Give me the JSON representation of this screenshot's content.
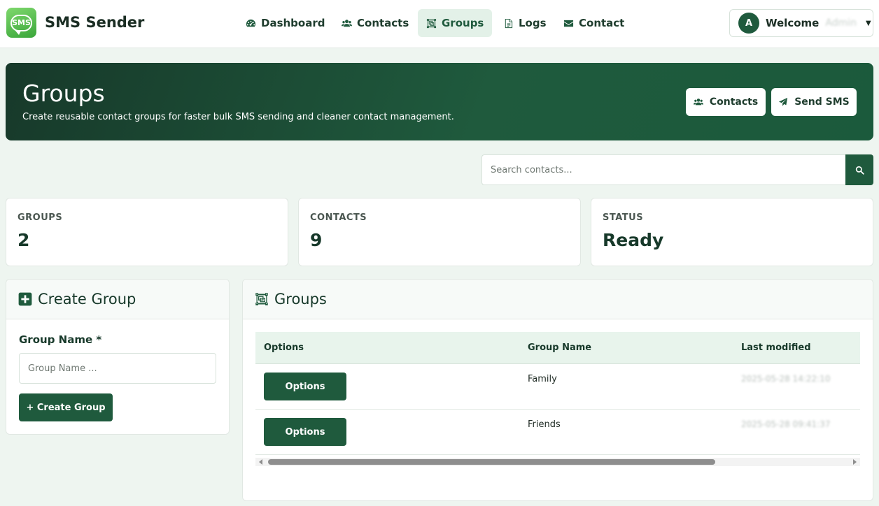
{
  "brand": {
    "logo_text": "SMS",
    "name": "SMS Sender"
  },
  "nav": {
    "items": [
      {
        "label": "Dashboard",
        "icon": "dashboard-icon"
      },
      {
        "label": "Contacts",
        "icon": "users-icon"
      },
      {
        "label": "Groups",
        "icon": "group-icon",
        "active": true
      },
      {
        "label": "Logs",
        "icon": "file-icon"
      },
      {
        "label": "Contact",
        "icon": "envelope-icon"
      }
    ],
    "user": {
      "initial": "A",
      "welcome": "Welcome",
      "name": "Admin"
    }
  },
  "hero": {
    "title": "Groups",
    "subtitle": "Create reusable contact groups for faster bulk SMS sending and cleaner contact management.",
    "buttons": [
      {
        "label": "Contacts",
        "icon": "users-icon"
      },
      {
        "label": "Send SMS",
        "icon": "paper-plane-icon"
      }
    ]
  },
  "search": {
    "placeholder": "Search contacts...",
    "icon": "search-icon"
  },
  "stats": [
    {
      "label": "GROUPS",
      "value": "2"
    },
    {
      "label": "CONTACTS",
      "value": "9"
    },
    {
      "label": "STATUS",
      "value": "Ready"
    }
  ],
  "create_panel": {
    "title": "Create Group",
    "icon": "plus-square-icon",
    "field_label": "Group Name *",
    "placeholder": "Group Name ...",
    "button_label": "+ Create Group"
  },
  "groups_panel": {
    "title": "Groups",
    "icon": "group-icon",
    "columns": [
      "Options",
      "Group Name",
      "Last modified"
    ],
    "rows": [
      {
        "button": "Options",
        "name": "Family",
        "modified": "2025-05-28 14:22:10"
      },
      {
        "button": "Options",
        "name": "Friends",
        "modified": "2025-05-28 09:41:37"
      }
    ]
  },
  "colors": {
    "primary": "#1f5a3d",
    "hero_dark": "#17392a",
    "background": "#eef5f0"
  }
}
